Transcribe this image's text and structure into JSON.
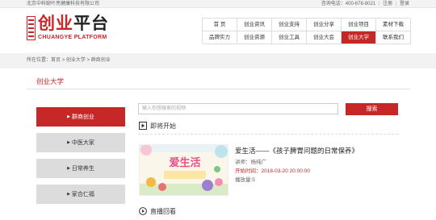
{
  "topbar": {
    "company": "北京中科聪叶亮健康科技有限公司",
    "hotline": "咨询电话：400-678-8021",
    "register": "注册",
    "login": "登录"
  },
  "logo": {
    "main_red": "创业",
    "main_dark": "平台",
    "sub": "CHUANGYE PLATFORM"
  },
  "nav": {
    "row1": [
      "首 页",
      "创业资讯",
      "创业支持",
      "创业分享",
      "创业项目",
      "素材下载"
    ],
    "row2": [
      "品牌实力",
      "创业资源",
      "创业工具",
      "创业大会",
      "创业大学",
      "联系我们"
    ],
    "active": "创业大学"
  },
  "breadcrumb": {
    "prefix": "所在位置：",
    "items": [
      "首页",
      "创业大学",
      "群商创业"
    ]
  },
  "section": {
    "title": "创业大学"
  },
  "menu": {
    "items": [
      "群商创业",
      "中医大家",
      "日常养生",
      "家合仁福"
    ],
    "active": "群商创业"
  },
  "search": {
    "placeholder": "输入你想搜索的视频",
    "button": "搜索"
  },
  "upcoming": {
    "heading": "即将开始",
    "course": {
      "thumb_title": "爱生活",
      "title": "爱生活——《孩子脾胃问题的日常保养》",
      "lecturer": "讲师：杨纯广",
      "start_time": "开始时间：2018-03-20 20:00:00",
      "plays": "播放量:5"
    }
  },
  "live": {
    "heading": "直播回看"
  },
  "colors": {
    "accent": "#c62828",
    "menu_bg": "#dcdcdc"
  },
  "icons": [
    "video-play-icon",
    "live-play-icon",
    "logo-seal-icon"
  ]
}
